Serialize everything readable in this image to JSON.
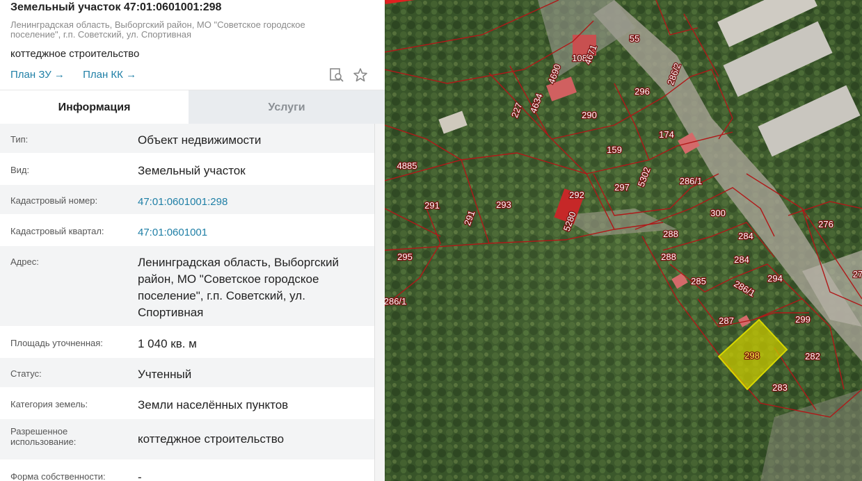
{
  "header": {
    "title": "Земельный участок 47:01:0601001:298",
    "address_line": "Ленинградская область, Выборгский район, МО \"Советское городское поселение\", г.п. Советский, ул. Спортивная",
    "usage": "коттеджное строительство",
    "link_plan_zu": "План ЗУ →",
    "link_plan_kk": "План КК →",
    "icons": [
      "search-document-icon",
      "star-icon"
    ]
  },
  "tabs": [
    {
      "label": "Информация",
      "active": true
    },
    {
      "label": "Услуги",
      "active": false
    }
  ],
  "info_rows": [
    {
      "label": "Тип:",
      "value": "Объект недвижимости"
    },
    {
      "label": "Вид:",
      "value": "Земельный участок"
    },
    {
      "label": "Кадастровый номер:",
      "value": "47:01:0601001:298",
      "link": true
    },
    {
      "label": "Кадастровый квартал:",
      "value": "47:01:0601001",
      "link": true
    },
    {
      "label": "Адрес:",
      "value": "Ленинградская область, Выборгский район, МО \"Советское городское поселение\", г.п. Советский, ул. Спортивная"
    },
    {
      "label": "Площадь уточненная:",
      "value": "1 040 кв. м"
    },
    {
      "label": "Статус:",
      "value": "Учтенный"
    },
    {
      "label": "Категория земель:",
      "value": "Земли населённых пунктов"
    },
    {
      "label": "Разрешенное использование:",
      "value": "коттеджное строительство"
    },
    {
      "label": "Форма собственности:",
      "value": "-"
    }
  ],
  "map": {
    "parcel_labels": [
      "55",
      "108",
      "4671",
      "4690",
      "296",
      "286/2",
      "4634",
      "227",
      "290",
      "174",
      "159",
      "4885",
      "292",
      "297",
      "5302",
      "286/1",
      "291",
      "291",
      "293",
      "5280",
      "300",
      "276",
      "288",
      "284",
      "295",
      "288",
      "284",
      "285",
      "294",
      "286/1",
      "286/1",
      "287",
      "299",
      "298",
      "282",
      "283",
      "27"
    ],
    "highlight_color": "#c8c800",
    "boundary_color": "#b01818"
  }
}
